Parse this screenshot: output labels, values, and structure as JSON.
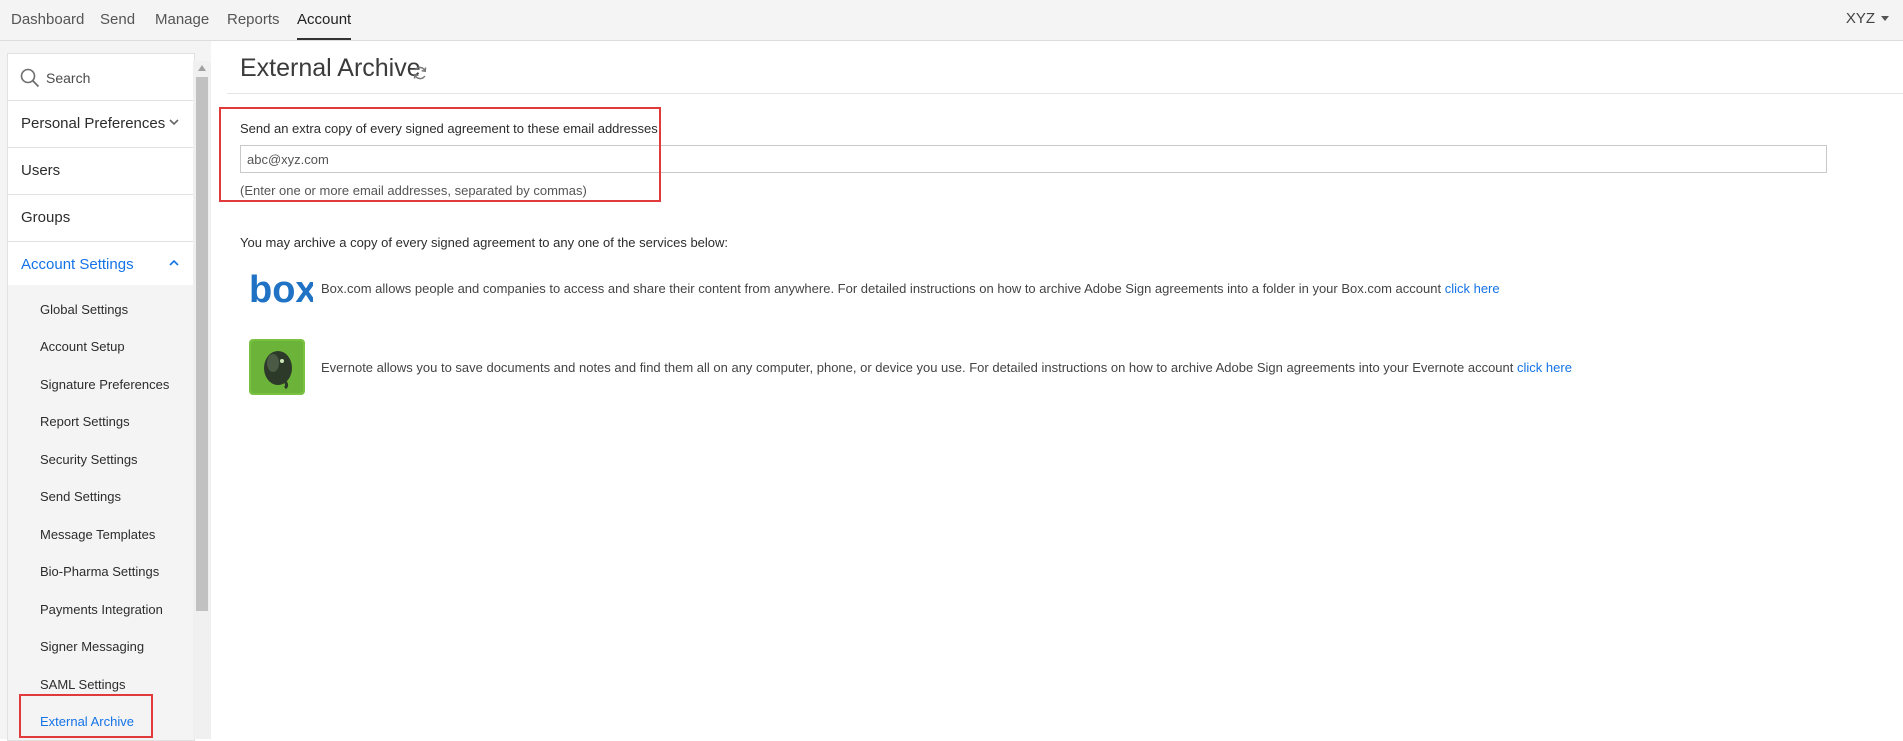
{
  "nav": {
    "tabs": [
      {
        "label": "Dashboard"
      },
      {
        "label": "Send"
      },
      {
        "label": "Manage"
      },
      {
        "label": "Reports"
      },
      {
        "label": "Account"
      }
    ],
    "active_tab": "Account",
    "user": "XYZ"
  },
  "sidebar": {
    "search_placeholder": "Search",
    "items": [
      {
        "label": "Personal Preferences",
        "chevron": "chevron-down"
      },
      {
        "label": "Users"
      },
      {
        "label": "Groups"
      },
      {
        "label": "Account Settings",
        "chevron": "chevron-up",
        "expanded": true
      }
    ],
    "sub_items": [
      {
        "label": "Global Settings"
      },
      {
        "label": "Account Setup"
      },
      {
        "label": "Signature Preferences"
      },
      {
        "label": "Report Settings"
      },
      {
        "label": "Security Settings"
      },
      {
        "label": "Send Settings"
      },
      {
        "label": "Message Templates"
      },
      {
        "label": "Bio-Pharma Settings"
      },
      {
        "label": "Payments Integration"
      },
      {
        "label": "Signer Messaging"
      },
      {
        "label": "SAML Settings"
      },
      {
        "label": "External Archive"
      }
    ],
    "active_sub_item": "External Archive"
  },
  "main": {
    "title": "External Archive",
    "email_label": "Send an extra copy of every signed agreement to these email addresses",
    "email_value": "abc@xyz.com",
    "email_hint": "(Enter one or more email addresses, separated by commas)",
    "archive_intro": "You may archive a copy of every signed agreement to any one of the services below:",
    "services": [
      {
        "name": "box",
        "logo_text": "box",
        "description": "Box.com allows people and companies to access and share their content from anywhere. For detailed instructions on how to archive Adobe Sign agreements into a folder in your Box.com account",
        "link": "click here"
      },
      {
        "name": "evernote",
        "description": "Evernote allows you to save documents and notes and find them all on any computer, phone, or device you use. For detailed instructions on how to archive Adobe Sign agreements into your Evernote account",
        "link": "click here"
      }
    ]
  },
  "colors": {
    "accent": "#1473e6",
    "highlight": "#e03a3a",
    "box_blue": "#1f72c4",
    "evernote_green": "#7ac142"
  }
}
